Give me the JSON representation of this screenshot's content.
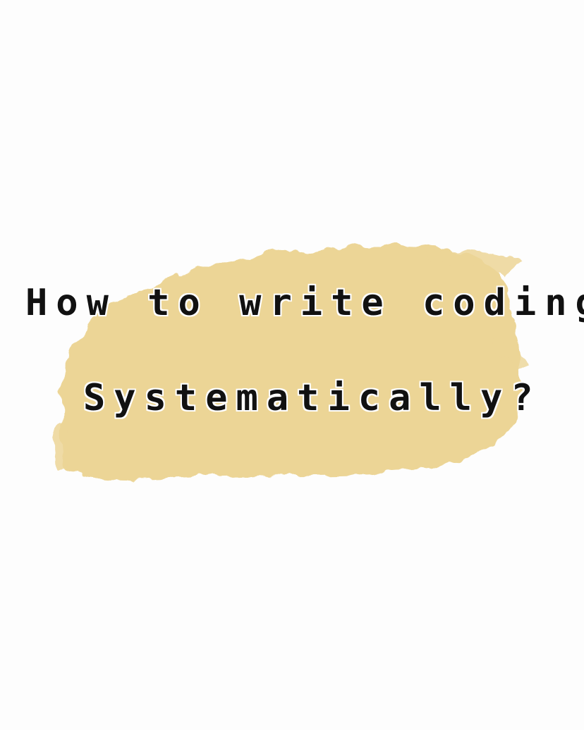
{
  "heading": {
    "line1": "How to write coding",
    "line2": "Systematically?"
  },
  "colors": {
    "background": "#fdfdfd",
    "brush_stroke": "#ecd596",
    "text": "#111111",
    "text_outline": "#ffffff"
  }
}
